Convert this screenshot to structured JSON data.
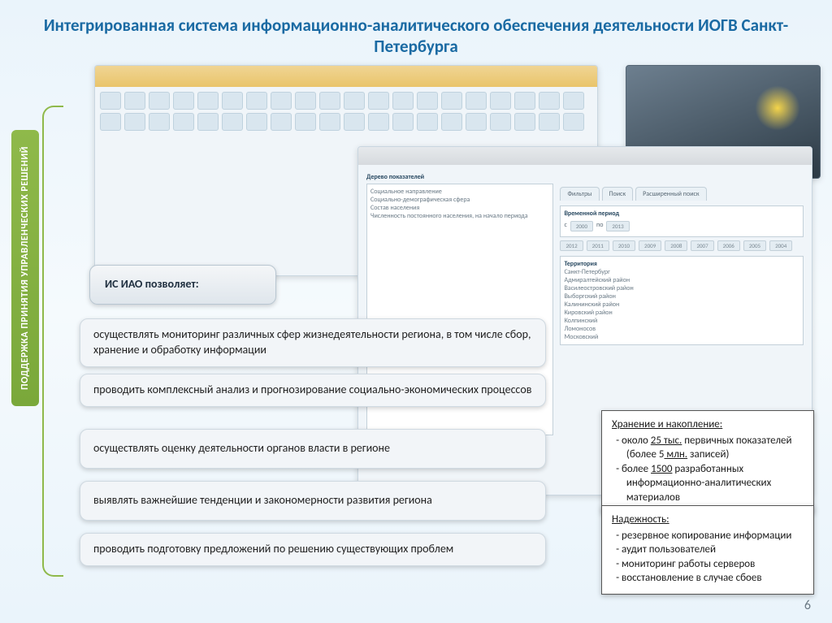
{
  "title": "Интегрированная система информационно-аналитического обеспечения деятельности ИОГВ Санкт-Петербурга",
  "vtab": "ПОДДЕРЖКА ПРИНЯТИЯ УПРАВЛЕНЧЕСКИХ РЕШЕНИЙ",
  "lead": "ИС ИАО позволяет:",
  "pills": [
    "осуществлять мониторинг различных сфер жизнедеятельности региона, в том числе сбор, хранение и обработку информации",
    "проводить комплексный анализ и прогнозирование социально-экономических процессов",
    "осуществлять оценку деятельности органов власти в регионе",
    "выявлять важнейшие тенденции и закономерности развития региона",
    "проводить подготовку предложений по решению существующих проблем"
  ],
  "storage": {
    "hd": "Хранение и накопление:",
    "l1a": "около ",
    "l1u": "25 тыс.",
    "l1b": " первичных показателей",
    "l2a": "(более 5",
    "l2u": " млн.",
    "l2b": " записей)",
    "l3a": "более ",
    "l3u": "1500",
    "l3b": " разработанных",
    "l4": "информационно-аналитических",
    "l5": "материалов"
  },
  "reliab": {
    "hd": "Надежность:",
    "items": [
      "резервное копирование информации",
      "аудит пользователей",
      "мониторинг работы серверов",
      "восстановление в случае сбоев"
    ]
  },
  "front": {
    "tree_title": "Дерево показателей",
    "tabs": [
      "Фильтры",
      "Поиск",
      "Расширенный поиск"
    ],
    "period_label": "Временной период",
    "year_from": "2000",
    "year_to": "2013",
    "territory_label": "Территория",
    "territory": [
      "Санкт-Петербург",
      "Адмиралтейский район",
      "Василеостровский район",
      "Выборгский район",
      "Калининский район",
      "Кировский район",
      "Колпинский",
      "Ломоносов",
      "Московский"
    ],
    "years_row": [
      "2012",
      "2011",
      "2010",
      "2009",
      "2008",
      "2007",
      "2006",
      "2005",
      "2004"
    ]
  },
  "pagenum": "6"
}
